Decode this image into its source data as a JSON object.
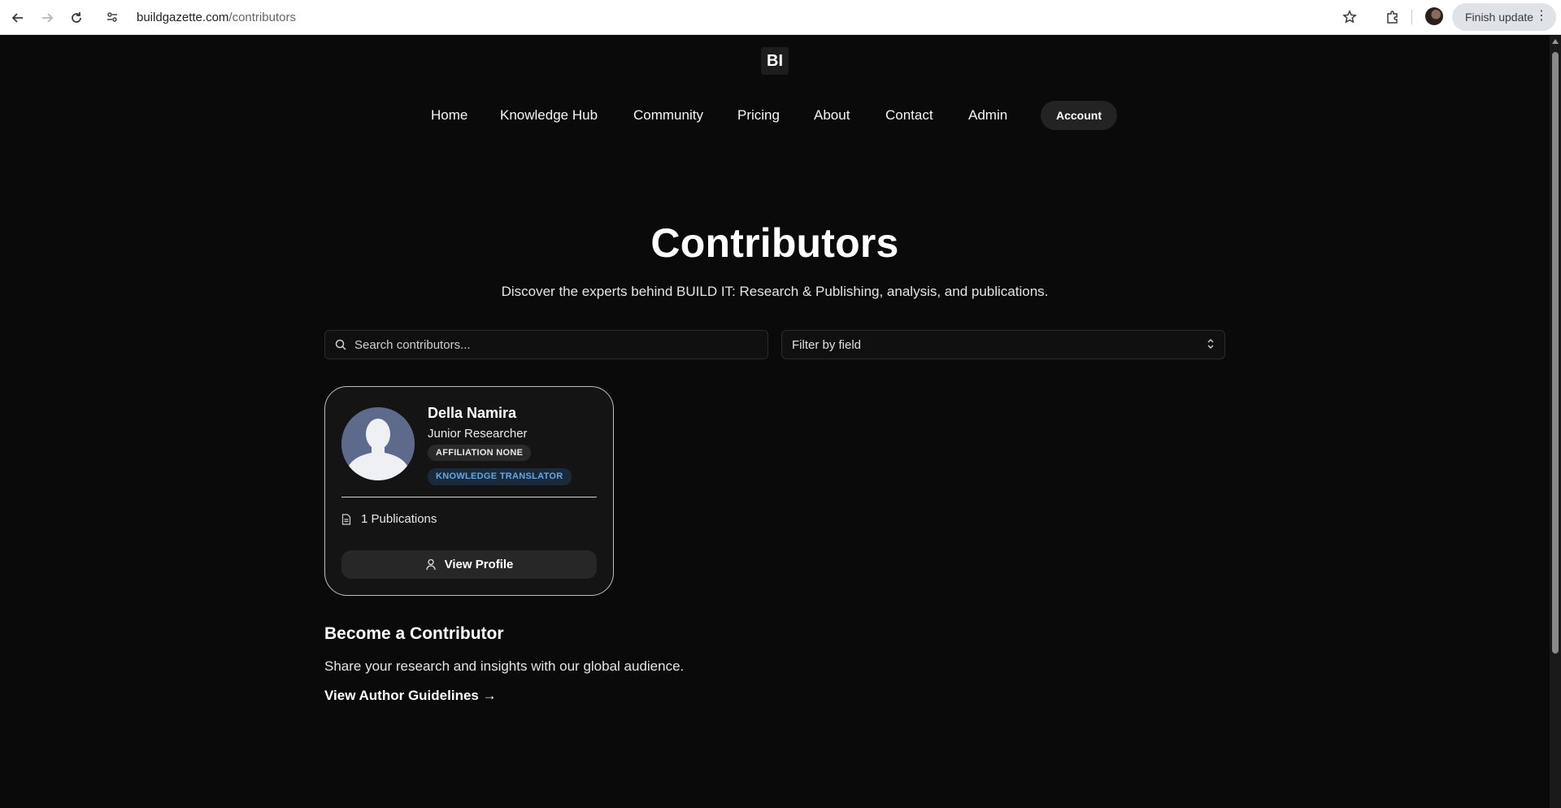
{
  "browser": {
    "url_domain": "buildgazette.com",
    "url_path": "/contributors",
    "finish_update_label": "Finish update"
  },
  "site": {
    "logo_text": "BI",
    "nav": {
      "home": "Home",
      "knowledge_hub": "Knowledge Hub",
      "community": "Community",
      "pricing": "Pricing",
      "about": "About",
      "contact": "Contact",
      "admin": "Admin",
      "account": "Account"
    }
  },
  "hero": {
    "title": "Contributors",
    "subtitle": "Discover the experts behind BUILD IT: Research & Publishing, analysis, and publications."
  },
  "filters": {
    "search_placeholder": "Search contributors...",
    "field_filter_value": "Filter by field"
  },
  "contributors": [
    {
      "name": "Della Namira",
      "role": "Junior Researcher",
      "affiliation_badge": "AFFILIATION NONE",
      "tag_badge": "KNOWLEDGE TRANSLATOR",
      "publications": "1 Publications",
      "view_profile_label": "View Profile"
    }
  ],
  "become": {
    "title": "Become a Contributor",
    "text": "Share your research and insights with our global audience.",
    "link": "View Author Guidelines →"
  },
  "icons": {
    "back": "arrow-left-icon",
    "forward": "arrow-right-icon",
    "reload": "reload-icon",
    "site_info": "site-settings-icon",
    "bookmark": "star-icon",
    "extensions": "puzzle-icon",
    "search": "search-icon",
    "select_chevron": "chevron-up-down-icon",
    "publications": "document-icon",
    "profile": "user-icon"
  },
  "colors": {
    "page_bg": "#0a0a0a",
    "card_border": "#bfbfbf",
    "accent_badge_text": "#62a8e6"
  }
}
